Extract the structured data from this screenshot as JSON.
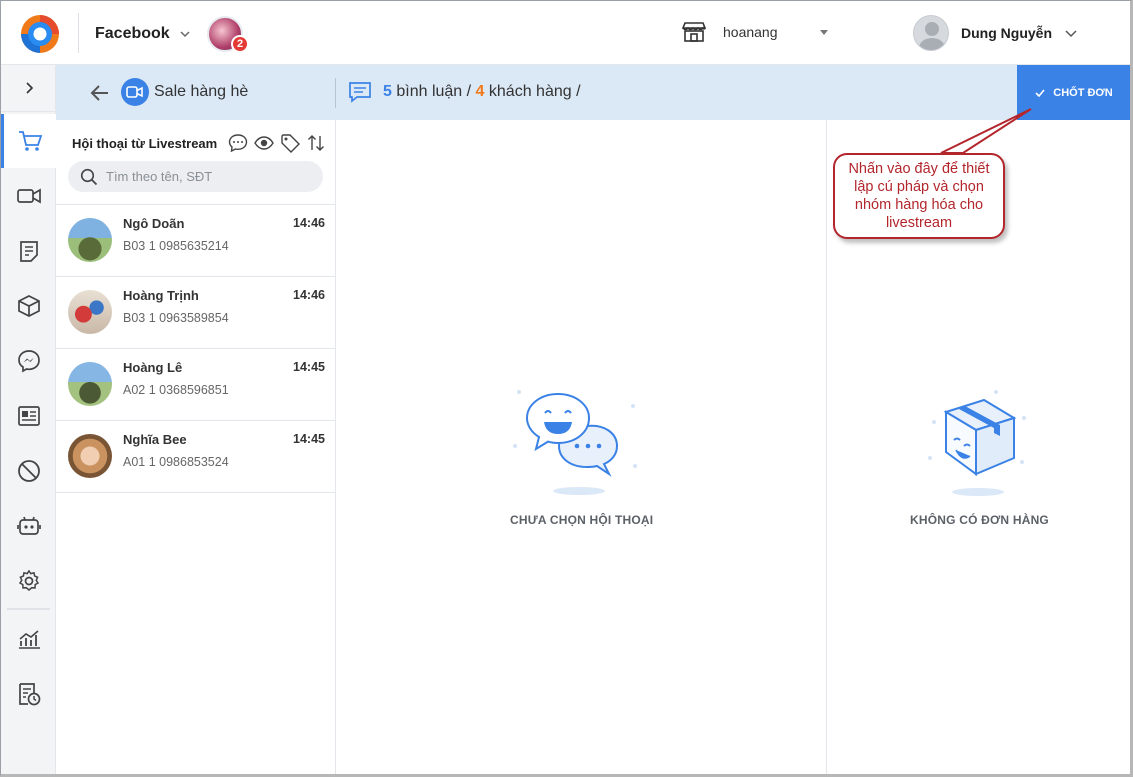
{
  "topbar": {
    "platform": "Facebook",
    "page_badge_count": "2",
    "store_name": "hoanang",
    "user_name": "Dung Nguyễn"
  },
  "subbar": {
    "live_title": "Sale hàng hè",
    "comments_count": "5",
    "comments_label": "bình luận /",
    "customers_count": "4",
    "customers_label": "khách hàng /",
    "close_order_label": "CHỐT ĐƠN"
  },
  "conversations": {
    "title": "Hội thoại từ Livestream",
    "search_placeholder": "Tìm theo tên, SĐT",
    "items": [
      {
        "name": "Ngô Doãn",
        "sub": "B03 1 0985635214",
        "time": "14:46"
      },
      {
        "name": "Hoàng Trịnh",
        "sub": "B03 1 0963589854",
        "time": "14:46"
      },
      {
        "name": "Hoàng Lê",
        "sub": "A02 1 0368596851",
        "time": "14:45"
      },
      {
        "name": "Nghĩa Bee",
        "sub": "A01 1 0986853524",
        "time": "14:45"
      }
    ]
  },
  "middle": {
    "empty_label": "CHƯA CHỌN HỘI THOẠI"
  },
  "right": {
    "empty_label": "KHÔNG CÓ ĐƠN HÀNG"
  },
  "callout": {
    "text": "Nhấn vào đây để thiết lập cú pháp và chọn nhóm hàng hóa cho livestream"
  },
  "rail": {
    "icons": [
      "cart-icon",
      "video-icon",
      "note-icon",
      "box-icon",
      "messenger-icon",
      "contact-card-icon",
      "block-icon",
      "bot-icon",
      "gear-icon",
      "chart-icon",
      "report-clock-icon"
    ]
  },
  "colors": {
    "accent": "#3b82e6",
    "orange": "#f07a1a",
    "callout": "#b3262c",
    "subbar": "#dbe8f6"
  }
}
